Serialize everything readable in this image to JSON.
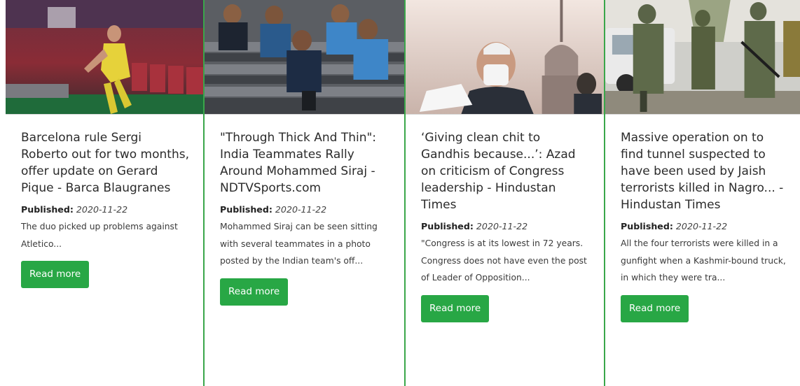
{
  "articles": [
    {
      "title": "Barcelona rule Sergi Roberto out for two months, offer update on Gerard Pique - Barca Blaugranes",
      "published_label": "Published:",
      "published_date": "2020-11-22",
      "description": "The duo picked up problems against Atletico...",
      "button_label": "Read more"
    },
    {
      "title": "\"Through Thick And Thin\": India Teammates Rally Around Mohammed Siraj - NDTVSports.com",
      "published_label": "Published:",
      "published_date": "2020-11-22",
      "description": "Mohammed Siraj can be seen sitting with several teammates in a photo posted by the Indian team's off...",
      "button_label": "Read more"
    },
    {
      "title": "‘Giving clean chit to Gandhis because...’: Azad on criticism of Congress leadership - Hindustan Times",
      "published_label": "Published:",
      "published_date": "2020-11-22",
      "description": "\"Congress is at its lowest in 72 years. Congress does not have even the post of Leader of Opposition...",
      "button_label": "Read more"
    },
    {
      "title": "Massive operation on to find tunnel suspected to have been used by Jaish terrorists killed in Nagro... - Hindustan Times",
      "published_label": "Published:",
      "published_date": "2020-11-22",
      "description": "All the four terrorists were killed in a gunfight when a Kashmir-bound truck, in which they were tra...",
      "button_label": "Read more"
    }
  ],
  "colors": {
    "accent": "#28a745",
    "divider": "#3aa64a"
  }
}
